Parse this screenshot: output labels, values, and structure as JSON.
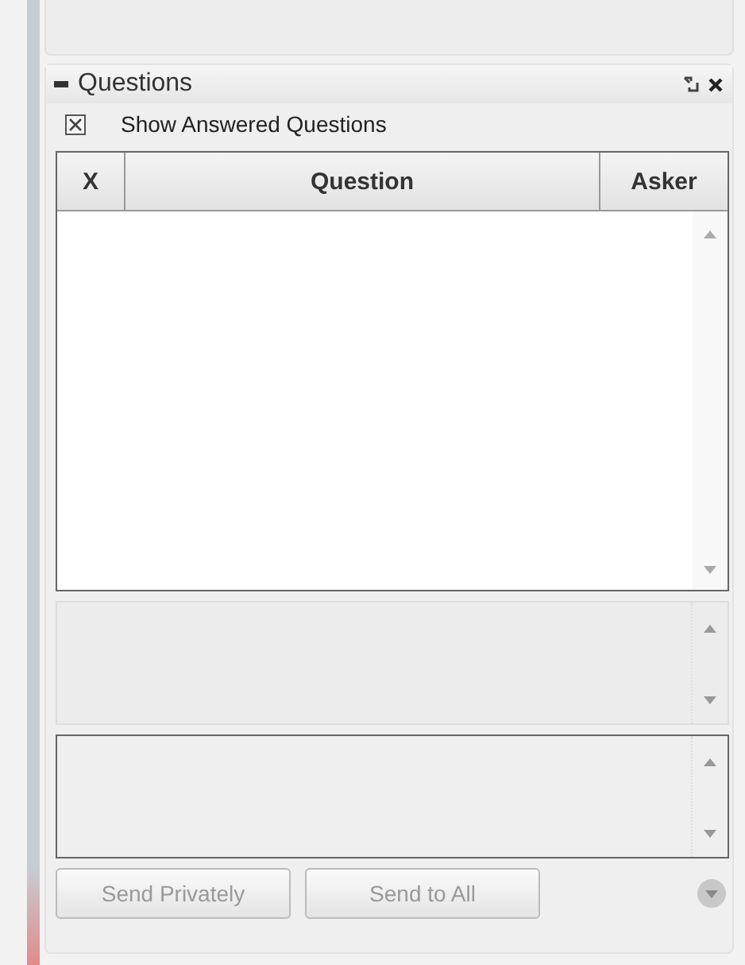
{
  "panel": {
    "title": "Questions"
  },
  "show_answered": {
    "label": "Show Answered Questions",
    "checked": true
  },
  "table": {
    "columns": [
      "X",
      "Question",
      "Asker"
    ]
  },
  "buttons": [
    {
      "label": "Send Privately",
      "disabled": true
    },
    {
      "label": "Send to All",
      "disabled": true
    }
  ]
}
